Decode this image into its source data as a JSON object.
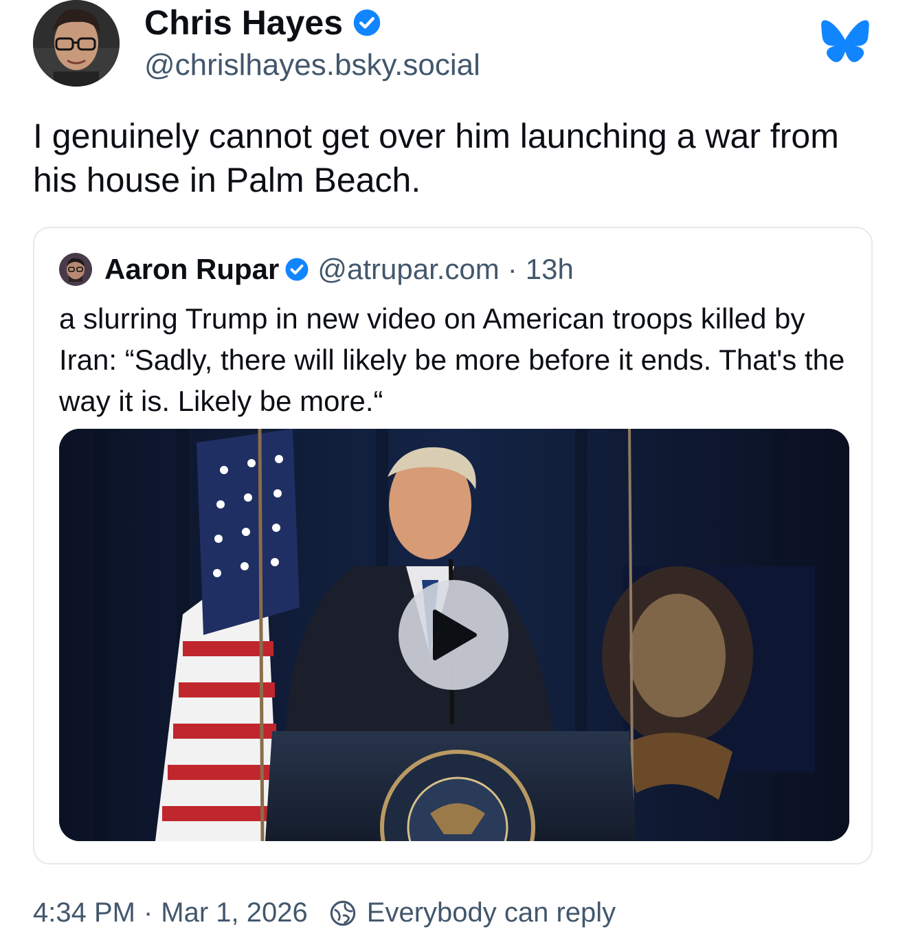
{
  "author": {
    "name": "Chris Hayes",
    "handle": "@chrislhayes.bsky.social",
    "verified": true,
    "avatar_icon": "avatar"
  },
  "brand": {
    "icon": "bluesky-butterfly-icon",
    "color": "#1185fe"
  },
  "post": {
    "text": "I genuinely cannot get over him launching a war from his house in Palm Beach."
  },
  "quote": {
    "author_name": "Aaron Rupar",
    "author_handle": "@atrupar.com",
    "separator": "·",
    "time": "13h",
    "text": "a slurring Trump in new video on American troops killed by Iran: “Sadly, there will likely be more before it ends. That's the way it is. Likely be more.“",
    "video": {
      "play_icon": "play-icon"
    }
  },
  "footer": {
    "time": "4:34 PM",
    "separator": "·",
    "date": "Mar 1, 2026",
    "reply_setting": "Everybody can reply",
    "reply_icon": "globe-reply-icon"
  },
  "colors": {
    "verified": "#1185fe",
    "text_primary": "#0b0f14",
    "text_secondary": "#42576c",
    "border": "#e6e9ee"
  }
}
